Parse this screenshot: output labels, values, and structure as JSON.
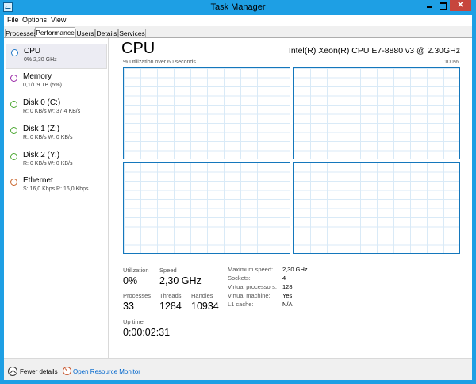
{
  "window": {
    "title": "Task Manager"
  },
  "menu": [
    "File",
    "Options",
    "View"
  ],
  "tabs": [
    "Processes",
    "Performance",
    "Users",
    "Details",
    "Services"
  ],
  "sidebar": {
    "items": [
      {
        "name": "CPU",
        "detail": "0% 2,30 GHz",
        "color": "#1e78c8",
        "selected": true
      },
      {
        "name": "Memory",
        "detail": "0,1/1,9 TB (5%)",
        "color": "#9b2aa8"
      },
      {
        "name": "Disk 0 (C:)",
        "detail": "R: 0 KB/s W: 37,4 KB/s",
        "color": "#4da833"
      },
      {
        "name": "Disk 1 (Z:)",
        "detail": "R: 0 KB/s W: 0 KB/s",
        "color": "#4da833"
      },
      {
        "name": "Disk 2 (Y:)",
        "detail": "R: 0 KB/s W: 0 KB/s",
        "color": "#4da833"
      },
      {
        "name": "Ethernet",
        "detail": "S: 16,0 Kbps R: 16,0 Kbps",
        "color": "#c8642a"
      }
    ]
  },
  "cpu": {
    "title": "CPU",
    "model": "Intel(R) Xeon(R) CPU E7-8880 v3 @ 2.30GHz",
    "graph_label": "% Utilization over 60 seconds",
    "graph_max": "100%",
    "stats": {
      "utilization_label": "Utilization",
      "utilization": "0%",
      "speed_label": "Speed",
      "speed": "2,30 GHz",
      "processes_label": "Processes",
      "processes": "33",
      "threads_label": "Threads",
      "threads": "1284",
      "handles_label": "Handles",
      "handles": "10934",
      "uptime_label": "Up time",
      "uptime": "0:00:02:31"
    },
    "details": [
      {
        "key": "Maximum speed:",
        "value": "2,30 GHz"
      },
      {
        "key": "Sockets:",
        "value": "4"
      },
      {
        "key": "Virtual processors:",
        "value": "128"
      },
      {
        "key": "Virtual machine:",
        "value": "Yes"
      },
      {
        "key": "L1 cache:",
        "value": "N/A"
      }
    ]
  },
  "footer": {
    "fewer_details": "Fewer details",
    "resource_monitor": "Open Resource Monitor"
  }
}
